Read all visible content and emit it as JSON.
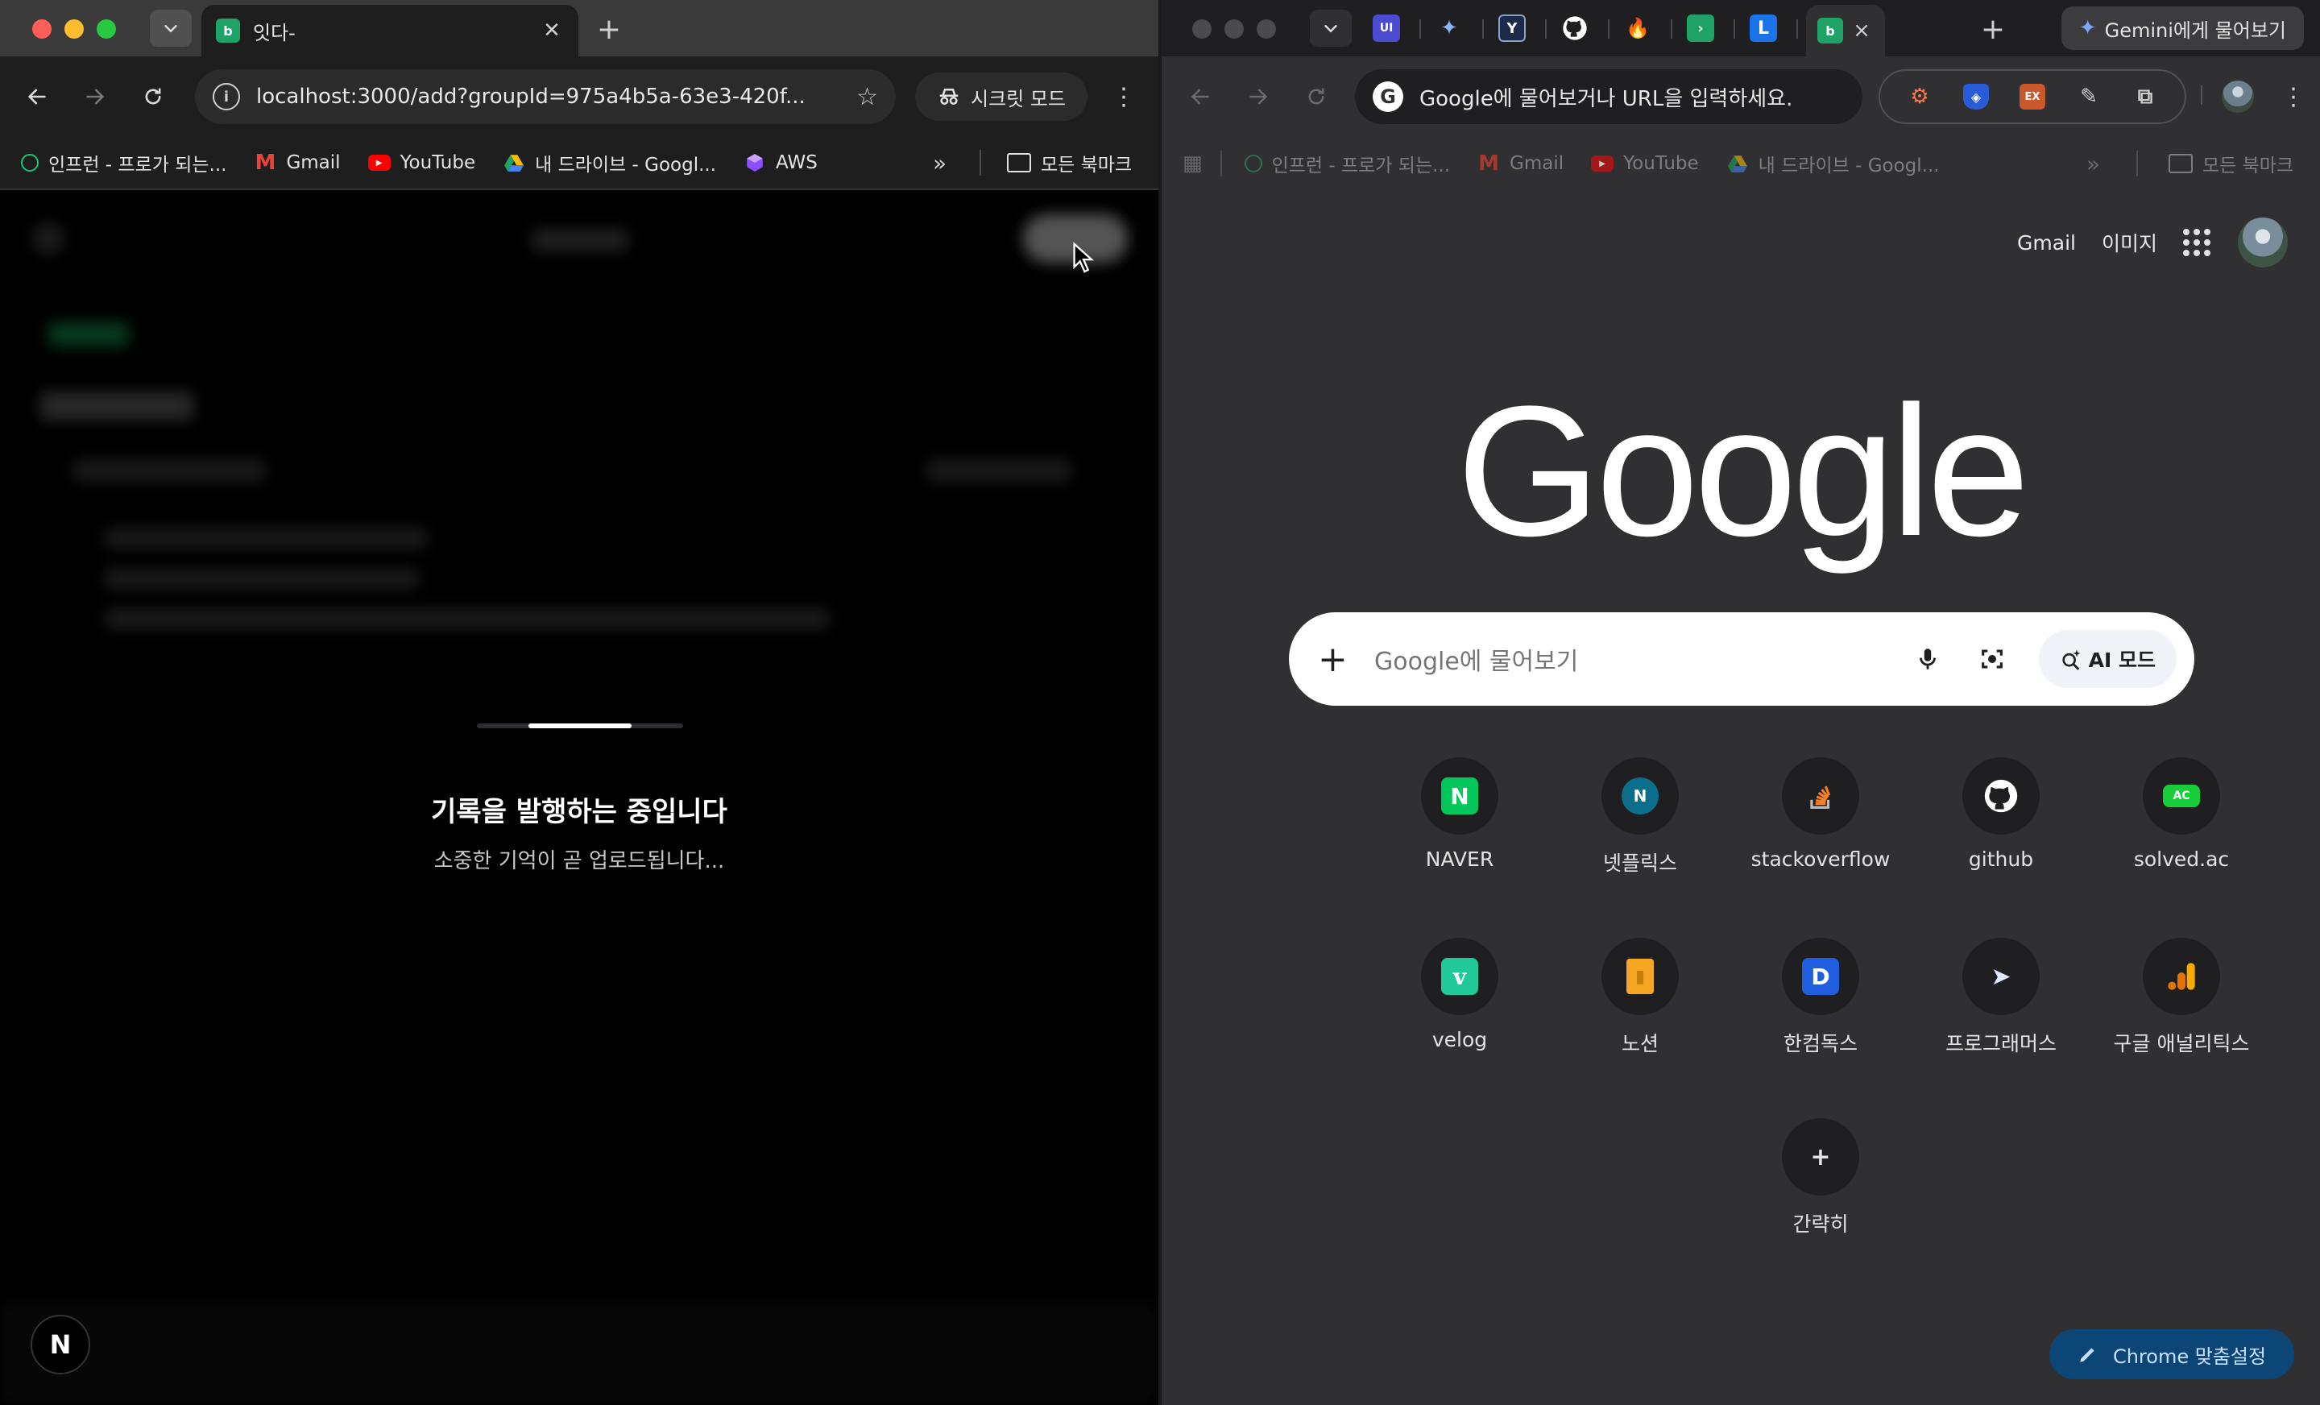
{
  "left": {
    "tab": {
      "title": "잇다-"
    },
    "omnibox": {
      "url": "localhost:3000/add?groupId=975a4b5a-63e3-420f..."
    },
    "incognito_label": "시크릿 모드",
    "bookmarks": [
      {
        "label": "인프런 - 프로가 되는...",
        "icon": "inflearn-icon",
        "color": "#1dc078"
      },
      {
        "label": "Gmail",
        "icon": "gmail-icon",
        "color": "#ea4335"
      },
      {
        "label": "YouTube",
        "icon": "youtube-icon",
        "color": "#ff0000"
      },
      {
        "label": "내 드라이브 - Googl...",
        "icon": "drive-icon",
        "color": "#1fa463"
      },
      {
        "label": "AWS",
        "icon": "aws-icon",
        "color": "#8c4fff"
      }
    ],
    "all_bookmarks": "모든 북마크",
    "loading": {
      "title": "기록을 발행하는 중입니다",
      "subtitle": "소중한 기억이 곧 업로드됩니다...",
      "progress": 0.5
    },
    "next_badge": "N"
  },
  "right": {
    "tab": {
      "close": "×"
    },
    "pinned_tabs": [
      {
        "letter": "UI",
        "color": "#4b4bd1"
      },
      {
        "letter": "✦",
        "color": "transparent"
      },
      {
        "letter": "Y",
        "color": "#1d2b4a"
      },
      {
        "letter": "",
        "color": "transparent"
      },
      {
        "letter": "🔥",
        "color": "transparent"
      },
      {
        "letter": "",
        "color": "#1fa265"
      },
      {
        "letter": "L",
        "color": "#1a73e8"
      }
    ],
    "gemini_label": "Gemini에게 물어보기",
    "omnibox": {
      "placeholder": "Google에 물어보거나 URL을 입력하세요."
    },
    "bookmarks": [
      {
        "label": "인프런 - 프로가 되는...",
        "icon": "inflearn-icon",
        "color": "#1dc078"
      },
      {
        "label": "Gmail",
        "icon": "gmail-icon",
        "color": "#ea4335"
      },
      {
        "label": "YouTube",
        "icon": "youtube-icon",
        "color": "#ff0000"
      },
      {
        "label": "내 드라이브 - Googl...",
        "icon": "drive-icon",
        "color": "#1fa463"
      }
    ],
    "all_bookmarks": "모든 북마크",
    "top_links": {
      "gmail": "Gmail",
      "images": "이미지"
    },
    "logo": "Google",
    "search": {
      "placeholder": "Google에 물어보기",
      "ai_mode": "AI 모드"
    },
    "shortcuts": [
      {
        "label": "NAVER",
        "glyph": "N",
        "color": "#03c75a"
      },
      {
        "label": "넷플릭스",
        "glyph": "N",
        "color": "#0b6e8a"
      },
      {
        "label": "stackoverflow",
        "glyph": "≡",
        "color": "transparent"
      },
      {
        "label": "github",
        "glyph": "",
        "color": "transparent"
      },
      {
        "label": "solved.ac",
        "glyph": "AC",
        "color": "#17ce3a"
      },
      {
        "label": "velog",
        "glyph": "v",
        "color": "#20c997"
      },
      {
        "label": "노션",
        "glyph": "▮",
        "color": "#f5a623"
      },
      {
        "label": "한컴독스",
        "glyph": "D",
        "color": "#1f5fe0"
      },
      {
        "label": "프로그래머스",
        "glyph": "➤",
        "color": "transparent"
      },
      {
        "label": "구글 애널리틱스",
        "glyph": "▮",
        "color": "transparent"
      },
      {
        "label": "간략히",
        "glyph": "+",
        "color": "transparent"
      }
    ],
    "customize_label": "Chrome 맞춤설정"
  }
}
